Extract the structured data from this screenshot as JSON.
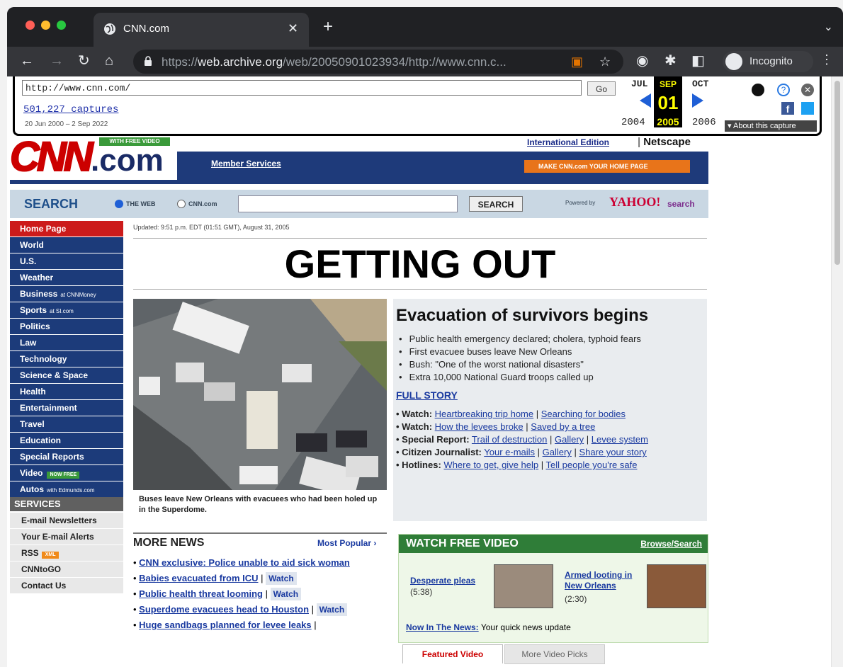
{
  "browser": {
    "tab_title": "CNN.com",
    "url_host": "web.archive.org",
    "url_prefix": "https://",
    "url_rest": "/web/20050901023934/http://www.cnn.c...",
    "incognito_label": "Incognito"
  },
  "wayback": {
    "url_value": "http://www.cnn.com/",
    "go_label": "Go",
    "captures": "501,227 captures",
    "range": "20 Jun 2000 – 2 Sep 2022",
    "months": {
      "prev": "JUL",
      "current": "SEP",
      "next": "OCT"
    },
    "day": "01",
    "years": {
      "prev": "2004",
      "current": "2005",
      "next": "2006"
    },
    "about": "About this capture"
  },
  "cnn": {
    "logo": "CNN",
    "logo_suffix": ".com",
    "with_free_video": "WITH FREE VIDEO",
    "intl": "International Edition",
    "netscape": "Netscape",
    "member_services": "Member Services",
    "make_home": "MAKE CNN.com YOUR HOME PAGE",
    "search": {
      "label": "SEARCH",
      "opt_web": "THE WEB",
      "opt_cnn": "CNN.com",
      "button": "SEARCH",
      "powered": "Powered by",
      "yahoo": "YAHOO!",
      "yahoo_search": "search"
    },
    "nav": [
      {
        "label": "Home Page",
        "sub": "",
        "badge": ""
      },
      {
        "label": "World",
        "sub": "",
        "badge": ""
      },
      {
        "label": "U.S.",
        "sub": "",
        "badge": ""
      },
      {
        "label": "Weather",
        "sub": "",
        "badge": ""
      },
      {
        "label": "Business",
        "sub": "at CNNMoney",
        "badge": ""
      },
      {
        "label": "Sports",
        "sub": "at SI.com",
        "badge": ""
      },
      {
        "label": "Politics",
        "sub": "",
        "badge": ""
      },
      {
        "label": "Law",
        "sub": "",
        "badge": ""
      },
      {
        "label": "Technology",
        "sub": "",
        "badge": ""
      },
      {
        "label": "Science & Space",
        "sub": "",
        "badge": ""
      },
      {
        "label": "Health",
        "sub": "",
        "badge": ""
      },
      {
        "label": "Entertainment",
        "sub": "",
        "badge": ""
      },
      {
        "label": "Travel",
        "sub": "",
        "badge": ""
      },
      {
        "label": "Education",
        "sub": "",
        "badge": ""
      },
      {
        "label": "Special Reports",
        "sub": "",
        "badge": ""
      },
      {
        "label": "Video",
        "sub": "",
        "badge": "NOW FREE"
      },
      {
        "label": "Autos",
        "sub": "with Edmunds.com",
        "badge": ""
      }
    ],
    "services": {
      "title": "SERVICES",
      "items": [
        "E-mail Newsletters",
        "Your E-mail Alerts",
        "RSS",
        "CNNtoGO",
        "Contact Us"
      ],
      "rss_badge": "XML"
    },
    "updated": "Updated: 9:51 p.m. EDT (01:51 GMT), August 31, 2005",
    "headline": "GETTING OUT",
    "photo_caption": "Buses leave New Orleans with evacuees who had been holed up in the Superdome.",
    "story": {
      "title": "Evacuation of survivors begins",
      "bullets": [
        "Public health emergency declared; cholera, typhoid fears",
        "First evacuee buses leave New Orleans",
        "Bush: \"One of the worst national disasters\"",
        "Extra 10,000 National Guard troops called up"
      ],
      "full_story": "FULL STORY",
      "links": [
        {
          "label": "Watch:",
          "items": [
            "Heartbreaking trip home",
            "Searching for bodies"
          ]
        },
        {
          "label": "Watch:",
          "items": [
            "How the levees broke",
            "Saved by a tree"
          ]
        },
        {
          "label": "Special Report:",
          "items": [
            "Trail of destruction",
            "Gallery",
            "Levee system"
          ]
        },
        {
          "label": "Citizen Journalist:",
          "items": [
            "Your e-mails",
            "Gallery",
            "Share your story"
          ]
        },
        {
          "label": "Hotlines:",
          "items": [
            "Where to get, give help",
            "Tell people you're safe"
          ]
        }
      ]
    },
    "more_news": {
      "title": "MORE NEWS",
      "popular": "Most Popular ›",
      "items": [
        {
          "text": "CNN exclusive: Police unable to aid sick woman",
          "watch": ""
        },
        {
          "text": "Babies evacuated from ICU",
          "watch": "Watch"
        },
        {
          "text": "Public health threat looming",
          "watch": "Watch"
        },
        {
          "text": "Superdome evacuees head to Houston",
          "watch": "Watch"
        },
        {
          "text": "Huge sandbags planned for levee leaks",
          "watch": ""
        }
      ]
    },
    "video": {
      "title": "WATCH FREE VIDEO",
      "browse": "Browse/Search",
      "v1_title": "Desperate pleas",
      "v1_dur": "(5:38)",
      "v2_title": "Armed looting in New Orleans",
      "v2_dur": "(2:30)",
      "now_label": "Now In The News:",
      "now_text": "Your quick news update",
      "tab_featured": "Featured Video",
      "tab_more": "More Video Picks"
    }
  }
}
